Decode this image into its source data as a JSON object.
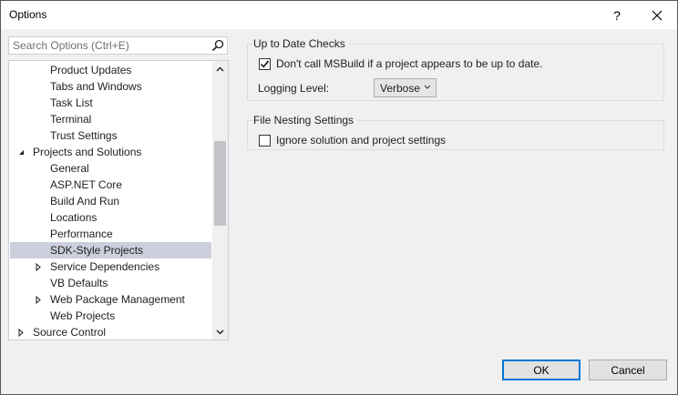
{
  "window": {
    "title": "Options",
    "help_label": "?",
    "close_label": "✕"
  },
  "search": {
    "placeholder": "Search Options (Ctrl+E)"
  },
  "tree": {
    "items": [
      {
        "label": "Product Updates",
        "level": 2
      },
      {
        "label": "Tabs and Windows",
        "level": 2
      },
      {
        "label": "Task List",
        "level": 2
      },
      {
        "label": "Terminal",
        "level": 2
      },
      {
        "label": "Trust Settings",
        "level": 2
      },
      {
        "label": "Projects and Solutions",
        "level": 1,
        "expander": "expanded"
      },
      {
        "label": "General",
        "level": 2
      },
      {
        "label": "ASP.NET Core",
        "level": 2
      },
      {
        "label": "Build And Run",
        "level": 2
      },
      {
        "label": "Locations",
        "level": 2
      },
      {
        "label": "Performance",
        "level": 2
      },
      {
        "label": "SDK-Style Projects",
        "level": 2,
        "selected": true
      },
      {
        "label": "Service Dependencies",
        "level": 2,
        "expander": "collapsed"
      },
      {
        "label": "VB Defaults",
        "level": 2
      },
      {
        "label": "Web Package Management",
        "level": 2,
        "expander": "collapsed"
      },
      {
        "label": "Web Projects",
        "level": 2
      },
      {
        "label": "Source Control",
        "level": 1,
        "expander": "collapsed"
      }
    ]
  },
  "up_to_date": {
    "title": "Up to Date Checks",
    "checkbox_label": "Don't call MSBuild if a project appears to be up to date.",
    "checked": true,
    "logging_label": "Logging Level:",
    "logging_value": "Verbose"
  },
  "file_nesting": {
    "title": "File Nesting Settings",
    "checkbox_label": "Ignore solution and project settings",
    "checked": false
  },
  "buttons": {
    "ok": "OK",
    "cancel": "Cancel"
  },
  "colors": {
    "accent": "#0078d7",
    "selected": "#cccedb"
  }
}
